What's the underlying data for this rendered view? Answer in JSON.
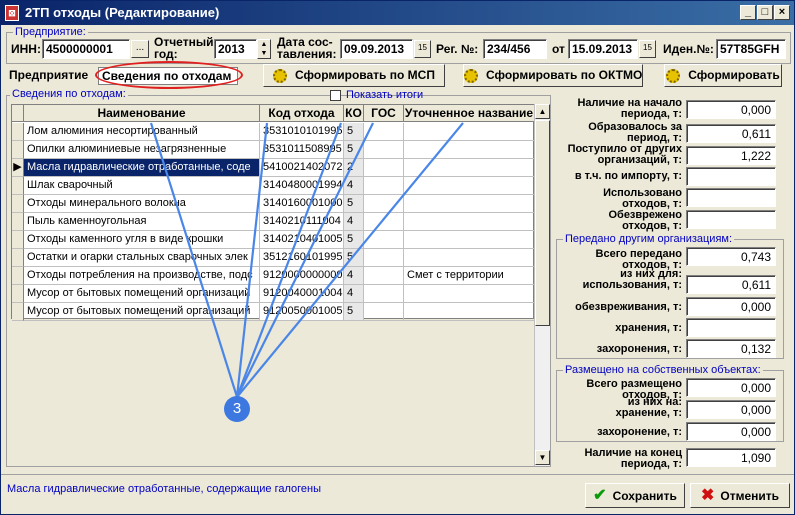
{
  "window": {
    "title": "2ТП отходы (Редактирование)",
    "title_icon": "document-icon",
    "controls": [
      "_",
      "□",
      "×"
    ]
  },
  "enterprise": {
    "group_label": "Предприятие:",
    "inn_label": "ИНН:",
    "inn_value": "4500000001",
    "inn_button": "...",
    "year_label_line1": "Отчетный",
    "year_label_line2": "год:",
    "year_value": "2013",
    "date_label_line1": "Дата сос-",
    "date_label_line2": "тавления:",
    "date_value": "09.09.2013",
    "reg_label": "Рег. №:",
    "reg_value": "234/456",
    "from_label": "от",
    "from_value": "15.09.2013",
    "ident_label": "Иден.№:",
    "ident_value": "57T85GFH",
    "calendar_icon": "15"
  },
  "tabs": [
    {
      "label": "Предприятие"
    },
    {
      "label": "Сведения по отходам"
    }
  ],
  "actions": {
    "msp": "Сформировать по МСП",
    "oktmo": "Сформировать по ОКТМО",
    "form": "Сформировать"
  },
  "waste_group_label": "Сведения по отходам:",
  "show_totals_label": "Показать итоги",
  "grid": {
    "headers": [
      "Наименование",
      "Код отхода",
      "КО",
      "ГОС",
      "Уточненное название"
    ],
    "rows": [
      {
        "name": "Лом алюминия несортированный",
        "code": "3531010101995",
        "ko": "5",
        "gos": "",
        "note": ""
      },
      {
        "name": "Опилки алюминиевые незагрязненные",
        "code": "3531011508995",
        "ko": "5",
        "gos": "",
        "note": ""
      },
      {
        "name": "Масла гидравлические отработанные, соде",
        "code": "5410021402072",
        "ko": "2",
        "gos": "",
        "note": ""
      },
      {
        "name": "Шлак сварочный",
        "code": "3140480001994",
        "ko": "4",
        "gos": "",
        "note": ""
      },
      {
        "name": "Отходы минерального волокна",
        "code": "3140160001000",
        "ko": "5",
        "gos": "",
        "note": ""
      },
      {
        "name": "Пыль каменноугольная",
        "code": "3140210111004",
        "ko": "4",
        "gos": "",
        "note": ""
      },
      {
        "name": "Отходы каменного угля в виде крошки",
        "code": "3140210401005",
        "ko": "5",
        "gos": "",
        "note": ""
      },
      {
        "name": "Остатки и огарки стальных сварочных элек",
        "code": "3512160101995",
        "ko": "5",
        "gos": "",
        "note": ""
      },
      {
        "name": "Отходы потребления на производстве, подс",
        "code": "9120000000000",
        "ko": "4",
        "gos": "",
        "note": "Смет с территории"
      },
      {
        "name": "Мусор от бытовых помещений организаций",
        "code": "9120040001004",
        "ko": "4",
        "gos": "",
        "note": ""
      },
      {
        "name": "Мусор от бытовых помещений организаций",
        "code": "9120050001005",
        "ko": "5",
        "gos": "",
        "note": ""
      }
    ]
  },
  "balance": {
    "start_l1": "Наличие на начало",
    "start_l2": "периода, т:",
    "start_v": "0,000",
    "formed_l1": "Образовалось за",
    "formed_l2": "период, т:",
    "formed_v": "0,611",
    "recv_l1": "Поступило от других",
    "recv_l2": "организаций, т:",
    "recv_v": "1,222",
    "import_l1": "в т.ч. по импорту, т:",
    "import_v": "",
    "used_l1": "Использовано",
    "used_l2": "отходов, т:",
    "used_v": "",
    "neutral_l1": "Обезврежено",
    "neutral_l2": "отходов, т:",
    "neutral_v": "",
    "transfer_group": "Передано другим организациям:",
    "tr_total_l1": "Всего передано",
    "tr_total_l2": "отходов, т:",
    "tr_total_v": "0,743",
    "tr_usage_l1": "из них для:",
    "tr_usage_l2": "использования, т:",
    "tr_usage_v": "0,611",
    "tr_neutral_l": "обезвреживания, т:",
    "tr_neutral_v": "0,000",
    "tr_storage_l": "хранения, т:",
    "tr_storage_v": "",
    "tr_burial_l": "захоронения, т:",
    "tr_burial_v": "0,132",
    "own_group": "Размещено на собственных объектах:",
    "own_total_l1": "Всего размещено",
    "own_total_l2": "отходов, т:",
    "own_total_v": "0,000",
    "own_storage_l1": "из них на:",
    "own_storage_l2": "хранение, т:",
    "own_storage_v": "0,000",
    "own_burial_l": "захоронение, т:",
    "own_burial_v": "0,000",
    "end_l1": "Наличие на конец",
    "end_l2": "периода, т:",
    "end_v": "1,090"
  },
  "status_text": "Масла гидравлические отработанные, содержащие галогены",
  "buttons": {
    "save": "Сохранить",
    "cancel": "Отменить"
  },
  "marker_label": "3"
}
